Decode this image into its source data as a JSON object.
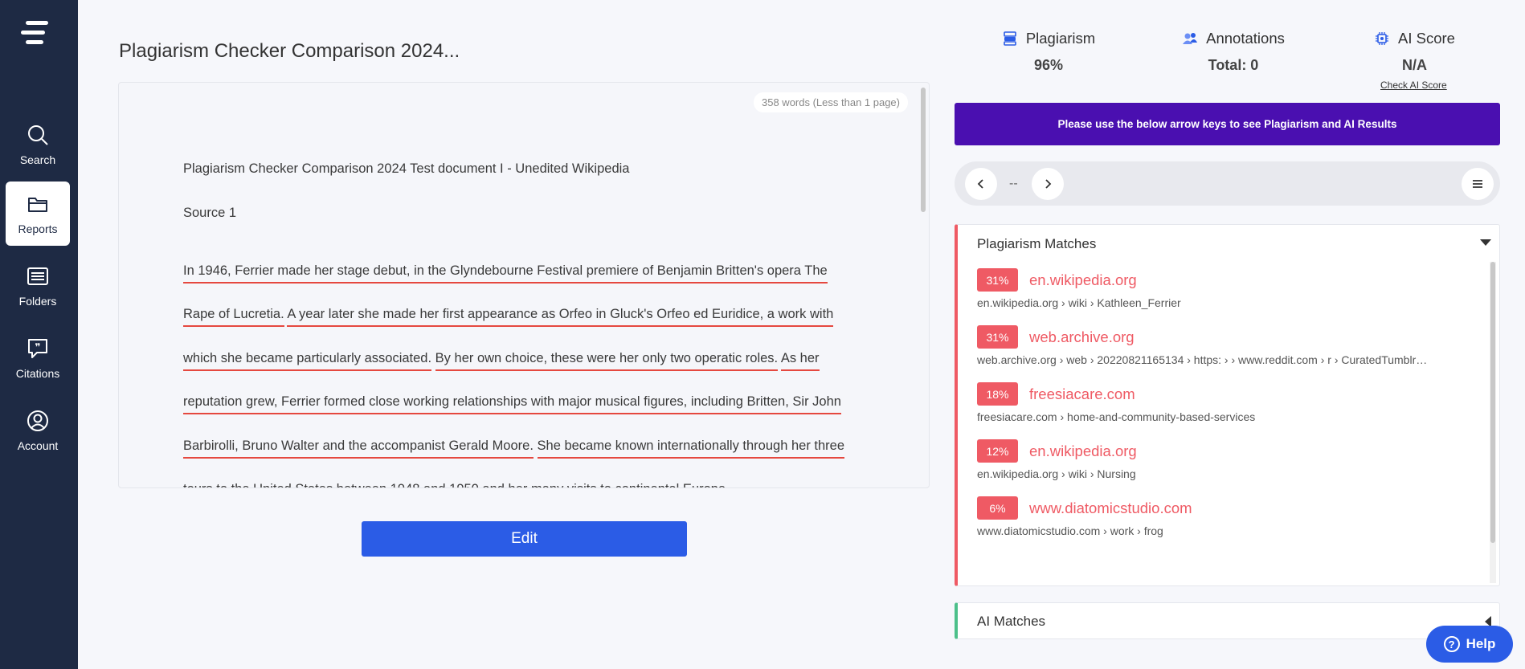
{
  "sidebar": {
    "items": [
      {
        "label": "Search",
        "icon": "search-icon"
      },
      {
        "label": "Reports",
        "icon": "folder-open-icon",
        "active": true
      },
      {
        "label": "Folders",
        "icon": "list-icon"
      },
      {
        "label": "Citations",
        "icon": "quote-bubble-icon"
      },
      {
        "label": "Account",
        "icon": "user-circle-icon"
      }
    ]
  },
  "document": {
    "title": "Plagiarism Checker Comparison 2024...",
    "word_count": "358 words (Less than 1 page)",
    "heading": "Plagiarism Checker Comparison 2024 Test document I - Unedited Wikipedia",
    "source": "Source 1",
    "sentences": [
      "In 1946, Ferrier made her stage debut, in the Glyndebourne Festival premiere of Benjamin Britten's opera The Rape of Lucretia.",
      "A year later she made her first appearance as Orfeo in Gluck's Orfeo ed Euridice, a work with which she became particularly associated.",
      "By her own choice, these were her only two operatic roles.",
      "As her reputation grew, Ferrier formed close working relationships with major musical figures, including Britten, Sir John Barbirolli, Bruno Walter and the accompanist Gerald Moore.",
      "She became known internationally through her three tours to the United States between 1948 and 1950 and her many visits to continental Europe."
    ],
    "edit_label": "Edit"
  },
  "stats": {
    "plagiarism_label": "Plagiarism",
    "plagiarism_value": "96%",
    "annotations_label": "Annotations",
    "annotations_value": "Total: 0",
    "ai_label": "AI Score",
    "ai_value": "N/A",
    "check_ai_label": "Check AI Score"
  },
  "banner": "Please use the below arrow keys to see Plagiarism and AI Results",
  "navigator": {
    "position": "--"
  },
  "plagiarism_matches": {
    "title": "Plagiarism Matches",
    "items": [
      {
        "percent": "31%",
        "domain": "en.wikipedia.org",
        "path": "en.wikipedia.org › wiki › Kathleen_Ferrier"
      },
      {
        "percent": "31%",
        "domain": "web.archive.org",
        "path": "web.archive.org › web › 20220821165134 › https: › › www.reddit.com › r › CuratedTumblr…"
      },
      {
        "percent": "18%",
        "domain": "freesiacare.com",
        "path": "freesiacare.com › home-and-community-based-services"
      },
      {
        "percent": "12%",
        "domain": "en.wikipedia.org",
        "path": "en.wikipedia.org › wiki › Nursing"
      },
      {
        "percent": "6%",
        "domain": "www.diatomicstudio.com",
        "path": "www.diatomicstudio.com › work › frog"
      }
    ]
  },
  "ai_matches": {
    "title": "AI Matches"
  },
  "help_label": "Help",
  "colors": {
    "sidebar": "#1e2a44",
    "accent": "#2b5ce6",
    "banner": "#4a0fb0",
    "match_red": "#ef5a64",
    "ai_green": "#4cc08a"
  }
}
